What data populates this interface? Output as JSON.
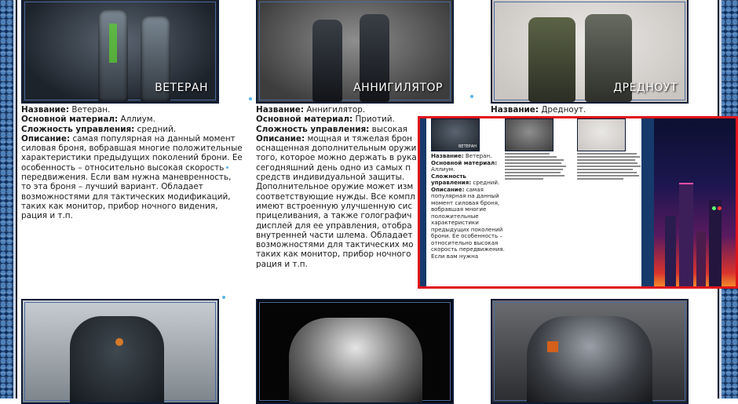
{
  "cards": [
    {
      "id": "veteran",
      "caption": "ВЕТЕРАН",
      "labels": {
        "name": "Название:",
        "material": "Основной материал:",
        "control": "Сложность управления:",
        "description": "Описание:"
      },
      "name": "Ветеран.",
      "material": "Аллиум.",
      "control": "средний.",
      "description": "самая популярная на данный момент силовая броня, вобравшая многие положительные характеристики предыдущих поколений брони. Ее особенность – относительно высокая скорость передвижения. Если вам нужна маневренность, то эта броня – лучший вариант. Обладает возможностями для тактических модификаций, таких как монитор, прибор ночного видения, рация и т.п."
    },
    {
      "id": "annihilator",
      "caption": "АННИГИЛЯТОР",
      "labels": {
        "name": "Название:",
        "material": "Основной материал:",
        "control": "Сложность управления:",
        "description": "Описание:"
      },
      "name": "Аннигилятор.",
      "material": "Приотий.",
      "control": "высокая",
      "description_lines": [
        "мощная и тяжелая брон",
        "оснащенная дополнительным оружи",
        "того, которое можно держать в рука",
        "сегодняшний день одно из самых п",
        "средств индивидуальной защиты.",
        "Дополнительное оружие может изм",
        "соответствующие нужды. Все компл",
        "имеют встроенную улучшенную сис",
        "прицеливания, а также голографич",
        "дисплей для ее управления, отобра",
        "внутренней части шлема. Обладает",
        "возможностями для тактических мо",
        "таких как монитор, прибор ночного",
        "рация и т.п."
      ]
    },
    {
      "id": "dreadnought",
      "caption": "ДРЕДНОУТ",
      "labels": {
        "name": "Название:"
      },
      "name": "Дредноут."
    }
  ],
  "preview": {
    "captions": [
      "ВЕТЕРАН"
    ],
    "labels": {
      "name": "Название:",
      "material": "Основной материал:",
      "control": "Сложность управления:",
      "description": "Описание:"
    },
    "name": "Ветеран.",
    "material": "Аллиум.",
    "control": "средний.",
    "description": "самая популярная на данный момент силовая броня, вобравшая многие положительные характеристики предыдущих поколений брони. Ее особенность – относительно высокая скорость передвижения. Если вам нужна"
  },
  "colors": {
    "highlight": "#e0141a",
    "frame": "#0e2f5b",
    "accent_dot": "#58b4e8"
  }
}
